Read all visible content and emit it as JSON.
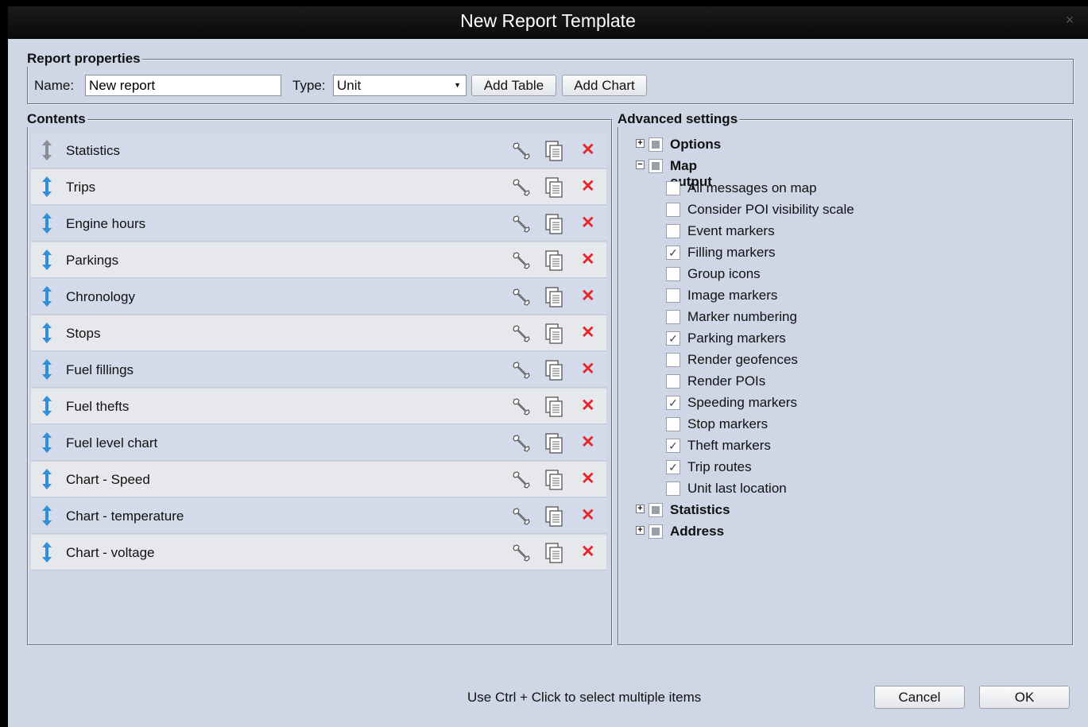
{
  "dialog": {
    "title": "New Report Template",
    "close_glyph": "×"
  },
  "report_properties": {
    "legend": "Report properties",
    "name_label": "Name:",
    "name_value": "New report",
    "type_label": "Type:",
    "type_value": "Unit",
    "add_table_label": "Add Table",
    "add_chart_label": "Add Chart"
  },
  "contents": {
    "legend": "Contents",
    "items": [
      {
        "label": "Statistics",
        "drag_color": "#8a8d93"
      },
      {
        "label": "Trips",
        "drag_color": "#2f8fd8"
      },
      {
        "label": "Engine hours",
        "drag_color": "#2f8fd8"
      },
      {
        "label": "Parkings",
        "drag_color": "#2f8fd8"
      },
      {
        "label": "Chronology",
        "drag_color": "#2f8fd8"
      },
      {
        "label": "Stops",
        "drag_color": "#2f8fd8"
      },
      {
        "label": "Fuel fillings",
        "drag_color": "#2f8fd8"
      },
      {
        "label": "Fuel thefts",
        "drag_color": "#2f8fd8"
      },
      {
        "label": "Fuel level chart",
        "drag_color": "#2f8fd8"
      },
      {
        "label": "Chart - Speed",
        "drag_color": "#2f8fd8"
      },
      {
        "label": "Chart - temperature",
        "drag_color": "#2f8fd8"
      },
      {
        "label": "Chart - voltage",
        "drag_color": "#2f8fd8"
      }
    ],
    "delete_glyph": "✕",
    "delete_color": "#e8242b"
  },
  "advanced": {
    "legend": "Advanced settings",
    "groups": {
      "options": {
        "label": "Options",
        "expander": "+"
      },
      "map_output": {
        "label": "Map output",
        "expander": "−"
      },
      "statistics": {
        "label": "Statistics",
        "expander": "+"
      },
      "address": {
        "label": "Address",
        "expander": "+"
      }
    },
    "map_options": [
      {
        "label": "All messages on map",
        "checked": false
      },
      {
        "label": "Consider POI visibility scale",
        "checked": false
      },
      {
        "label": "Event markers",
        "checked": false
      },
      {
        "label": "Filling markers",
        "checked": true
      },
      {
        "label": "Group icons",
        "checked": false
      },
      {
        "label": "Image markers",
        "checked": false
      },
      {
        "label": "Marker numbering",
        "checked": false
      },
      {
        "label": "Parking markers",
        "checked": true
      },
      {
        "label": "Render geofences",
        "checked": false
      },
      {
        "label": "Render POIs",
        "checked": false
      },
      {
        "label": "Speeding markers",
        "checked": true
      },
      {
        "label": "Stop markers",
        "checked": false
      },
      {
        "label": "Theft markers",
        "checked": true
      },
      {
        "label": "Trip routes",
        "checked": true
      },
      {
        "label": "Unit last location",
        "checked": false
      }
    ],
    "check_glyph": "✓"
  },
  "footer": {
    "hint": "Use Ctrl + Click to select multiple items",
    "cancel_label": "Cancel",
    "ok_label": "OK"
  }
}
